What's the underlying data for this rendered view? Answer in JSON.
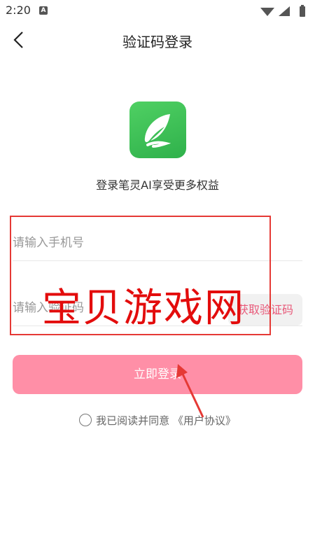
{
  "status": {
    "time": "2:20",
    "notification_badge": "A"
  },
  "header": {
    "title": "验证码登录"
  },
  "logo": {
    "name": "app-logo-feather"
  },
  "subtitle": "登录笔灵AI享受更多权益",
  "phone_field": {
    "placeholder": "请输入手机号",
    "value": ""
  },
  "code_field": {
    "placeholder": "请输入验证码",
    "value": "",
    "get_code_label": "获取验证码"
  },
  "login_button": "立即登录",
  "agreement": {
    "text": "我已阅读并同意",
    "link": "《用户协议》"
  },
  "watermark": "宝贝游戏网",
  "colors": {
    "accent": "#ff8fa7",
    "logo_green": "#3cbf55",
    "annotation_red": "#e53935"
  }
}
